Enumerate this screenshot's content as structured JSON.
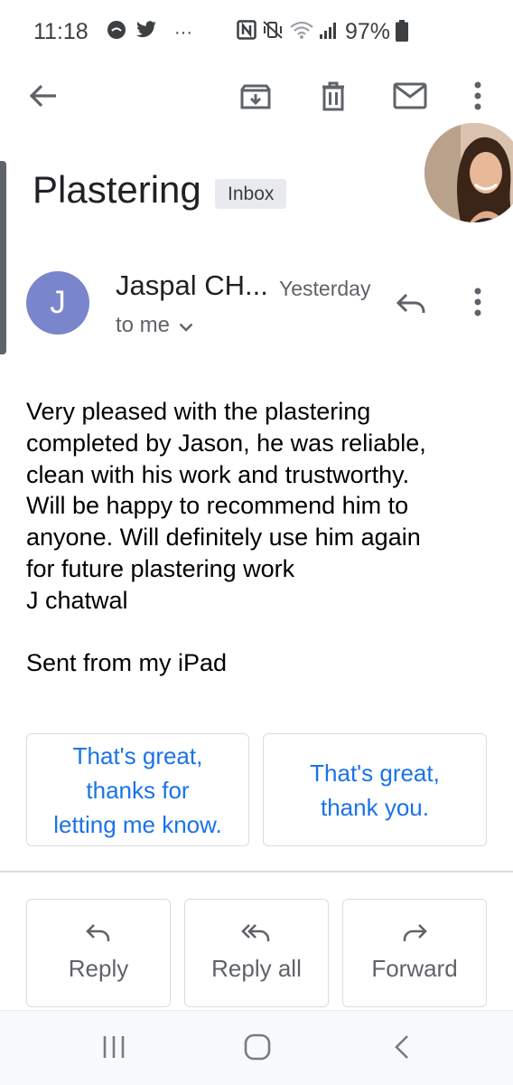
{
  "status_bar": {
    "time": "11:18",
    "battery": "97%",
    "icons": [
      "circle-notification-icon",
      "twitter-icon",
      "more-notifications-icon",
      "nfc-icon",
      "vibrate-mute-icon",
      "wifi-icon",
      "signal-icon",
      "battery-icon"
    ]
  },
  "toolbar": {
    "icons": [
      "back-arrow-icon",
      "archive-icon",
      "delete-icon",
      "mark-unread-icon",
      "overflow-menu-icon"
    ]
  },
  "email": {
    "subject": "Plastering",
    "label": "Inbox",
    "sender_initial": "J",
    "sender_name": "Jaspal CH...",
    "date": "Yesterday",
    "recipient": "to me",
    "body_lines": [
      "Very pleased with the plastering",
      "completed by Jason, he was reliable,",
      "clean with his work and trustworthy.",
      "Will be happy to recommend him to",
      "anyone. Will definitely use him again",
      "for future plastering work",
      "J chatwal"
    ],
    "signature": "Sent from my iPad"
  },
  "smart_replies": [
    {
      "lines": [
        "That's great,",
        "thanks for",
        "letting me know."
      ]
    },
    {
      "lines": [
        "That's great,",
        "thank you."
      ]
    }
  ],
  "actions": {
    "reply": "Reply",
    "reply_all": "Reply all",
    "forward": "Forward"
  },
  "colors": {
    "accent_blue": "#1a73e8",
    "avatar_purple": "#7986cb",
    "chip_gray": "#e8eaed",
    "icon_gray": "#5f6368"
  }
}
